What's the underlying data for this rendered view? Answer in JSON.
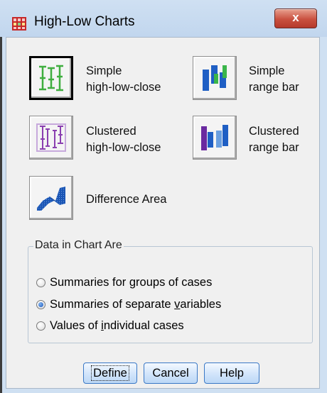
{
  "window": {
    "title": "High-Low Charts",
    "close_label": "x"
  },
  "charts": {
    "simple_hlc": "Simple\nhigh-low-close",
    "simple_hlc_line1": "Simple",
    "simple_hlc_line2": "high-low-close",
    "simple_range_line1": "Simple",
    "simple_range_line2": "range bar",
    "clustered_hlc_line1": "Clustered",
    "clustered_hlc_line2": "high-low-close",
    "clustered_range_line1": "Clustered",
    "clustered_range_line2": "range bar",
    "difference_area": "Difference Area",
    "selected": "simple_hlc"
  },
  "data_group": {
    "title": "Data in Chart Are",
    "options": [
      {
        "pre": "Summaries for ",
        "key": "g",
        "post": "roups of cases",
        "checked": false
      },
      {
        "pre": "Summaries of separate ",
        "key": "v",
        "post": "ariables",
        "checked": true
      },
      {
        "pre": "Values of ",
        "key": "i",
        "post": "ndividual cases",
        "checked": false
      }
    ]
  },
  "buttons": {
    "define": "Define",
    "cancel": "Cancel",
    "help": "Help"
  },
  "colors": {
    "hlc_green": "#3fae3f",
    "hlc_purple": "#8a3fb0",
    "range_blue": "#1f5fc4",
    "range_green": "#3ab54a",
    "range_purple": "#6a2aa0",
    "area_blue": "#1b56b5"
  },
  "icons": {
    "title": "grid-chart-icon",
    "simple_hlc": "simple-high-low-close-icon",
    "simple_range": "simple-range-bar-icon",
    "clustered_hlc": "clustered-high-low-close-icon",
    "clustered_range": "clustered-range-bar-icon",
    "difference_area": "difference-area-icon"
  }
}
